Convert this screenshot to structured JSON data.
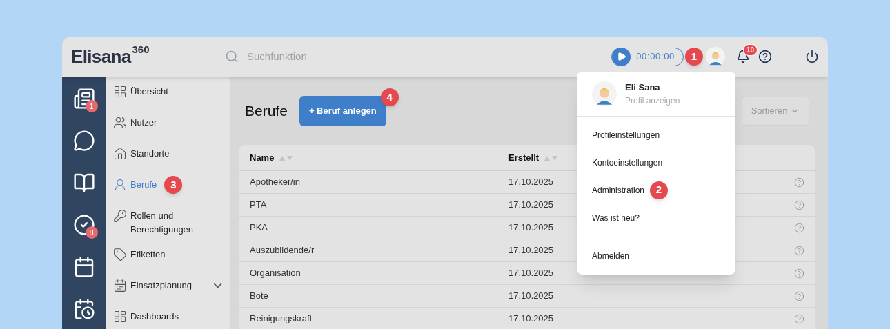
{
  "header": {
    "logo": "Elisana",
    "logo_sup": "360",
    "search": {
      "placeholder": "Suchfunktion"
    },
    "timer": "00:00:00",
    "notifications": "10"
  },
  "rail": [
    {
      "kind": "news",
      "badge": "1"
    },
    {
      "kind": "chat"
    },
    {
      "kind": "book"
    },
    {
      "kind": "tasks",
      "badge": "8"
    },
    {
      "kind": "calendar"
    },
    {
      "kind": "schedule"
    }
  ],
  "sidebar": {
    "items": [
      {
        "label": "Übersicht",
        "selected": false
      },
      {
        "label": "Nutzer",
        "selected": false
      },
      {
        "label": "Standorte",
        "selected": false
      },
      {
        "label": "Berufe",
        "selected": true,
        "callout": "3"
      },
      {
        "label": "Rollen und Berechtigungen",
        "selected": false
      },
      {
        "label": "Etiketten",
        "selected": false
      },
      {
        "label": "Einsatzplanung",
        "selected": false,
        "kind": "group"
      },
      {
        "label": "Dashboards",
        "selected": false
      }
    ]
  },
  "page": {
    "title": "Berufe",
    "add_button": "+ Beruf anlegen",
    "add_callout": "4",
    "sort_button": "Sortieren"
  },
  "table": {
    "columns": [
      "Name",
      "Erstellt"
    ],
    "rows": [
      [
        "Apotheker/in",
        "17.10.2025"
      ],
      [
        "PTA",
        "17.10.2025"
      ],
      [
        "PKA",
        "17.10.2025"
      ],
      [
        "Auszubildende/r",
        "17.10.2025"
      ],
      [
        "Organisation",
        "17.10.2025"
      ],
      [
        "Bote",
        "17.10.2025"
      ],
      [
        "Reinigungskraft",
        "17.10.2025"
      ]
    ]
  },
  "profile_menu": {
    "avatar_callout": "1",
    "name": "Eli Sana",
    "subtitle": "Profil anzeigen",
    "groups": [
      [
        {
          "label": "Profileinstellungen"
        },
        {
          "label": "Kontoeinstellungen"
        },
        {
          "label": "Administration",
          "callout": "2"
        },
        {
          "label": "Was ist neu?"
        }
      ],
      [
        {
          "label": "Abmelden"
        }
      ]
    ]
  }
}
